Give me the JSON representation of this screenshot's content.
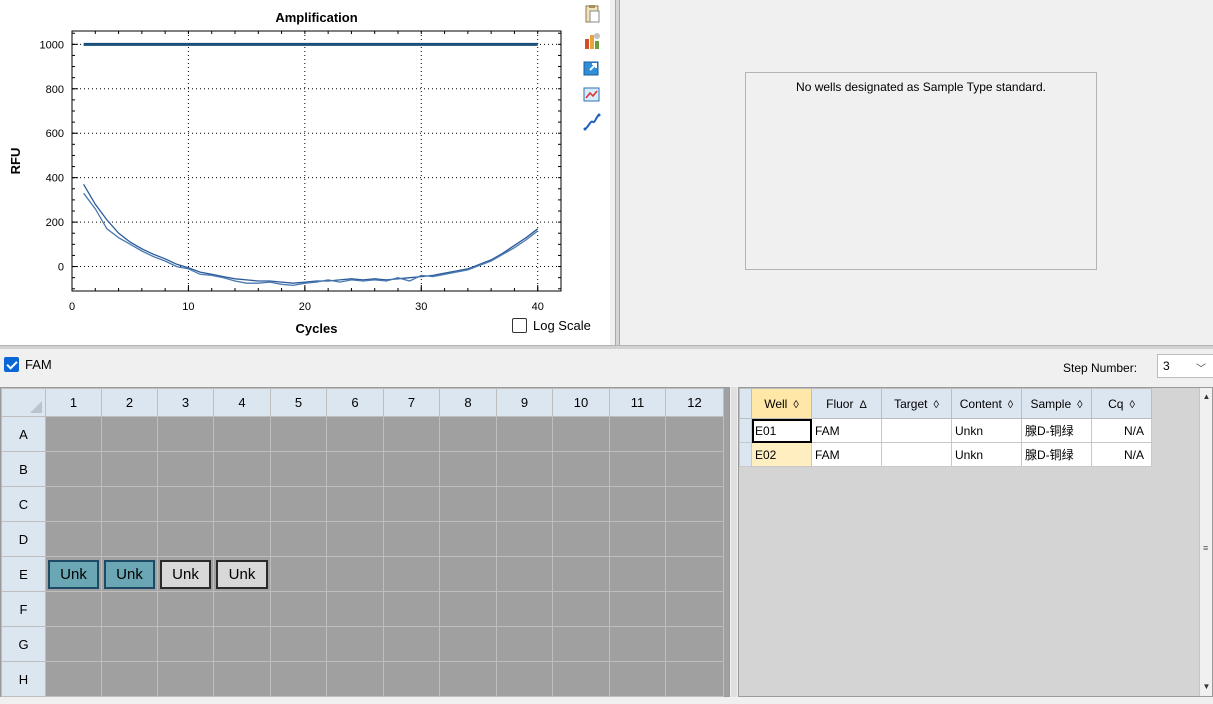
{
  "chart_data": {
    "type": "line",
    "title": "Amplification",
    "xlabel": "Cycles",
    "ylabel": "RFU",
    "xlim": [
      0,
      42
    ],
    "ylim": [
      -110,
      1060
    ],
    "xticks": [
      0,
      10,
      20,
      30,
      40
    ],
    "yticks": [
      0,
      200,
      400,
      600,
      800,
      1000
    ],
    "grid": true,
    "color": "#1f4e8c",
    "threshold": {
      "x": [
        1,
        40
      ],
      "y": [
        1000,
        1000
      ]
    },
    "series": [
      {
        "x": [
          1,
          2,
          3,
          4,
          5,
          6,
          7,
          8,
          9,
          10,
          11,
          12,
          13,
          14,
          15,
          16,
          17,
          18,
          19,
          20,
          21,
          22,
          23,
          24,
          25,
          26,
          27,
          28,
          29,
          30,
          31,
          32,
          33,
          34,
          35,
          36,
          37,
          38,
          39,
          40
        ],
        "y": [
          370,
          280,
          210,
          150,
          110,
          80,
          55,
          35,
          10,
          -5,
          -25,
          -35,
          -45,
          -55,
          -60,
          -65,
          -65,
          -70,
          -75,
          -70,
          -65,
          -65,
          -60,
          -55,
          -60,
          -55,
          -60,
          -55,
          -50,
          -45,
          -40,
          -30,
          -20,
          -10,
          10,
          30,
          60,
          95,
          130,
          170
        ]
      },
      {
        "x": [
          1,
          2,
          3,
          4,
          5,
          6,
          7,
          8,
          9,
          10,
          11,
          12,
          13,
          14,
          15,
          16,
          17,
          18,
          19,
          20,
          21,
          22,
          23,
          24,
          25,
          26,
          27,
          28,
          29,
          30,
          31,
          32,
          33,
          34,
          35,
          36,
          37,
          38,
          39,
          40
        ],
        "y": [
          330,
          260,
          170,
          130,
          100,
          70,
          45,
          25,
          0,
          -10,
          -35,
          -40,
          -50,
          -65,
          -75,
          -75,
          -70,
          -80,
          -85,
          -75,
          -70,
          -60,
          -70,
          -60,
          -65,
          -60,
          -65,
          -50,
          -65,
          -40,
          -45,
          -35,
          -25,
          -15,
          5,
          25,
          55,
          85,
          120,
          160
        ]
      }
    ]
  },
  "chart_ui": {
    "log_scale_label": "Log Scale",
    "tools": [
      "clipboard-icon",
      "bar-chart-icon",
      "export-icon",
      "zoom-chart-icon",
      "curve-icon"
    ]
  },
  "std_curve": {
    "message": "No wells designated as Sample Type standard."
  },
  "fluor": {
    "label": "FAM",
    "checked": true
  },
  "step": {
    "label": "Step Number:",
    "value": "3"
  },
  "plate": {
    "columns": [
      "1",
      "2",
      "3",
      "4",
      "5",
      "6",
      "7",
      "8",
      "9",
      "10",
      "11",
      "12"
    ],
    "rows": [
      "A",
      "B",
      "C",
      "D",
      "E",
      "F",
      "G",
      "H"
    ],
    "wells": [
      {
        "row": "E",
        "col": "1",
        "label": "Unk",
        "selected": true
      },
      {
        "row": "E",
        "col": "2",
        "label": "Unk",
        "selected": true
      },
      {
        "row": "E",
        "col": "3",
        "label": "Unk",
        "selected": false
      },
      {
        "row": "E",
        "col": "4",
        "label": "Unk",
        "selected": false
      }
    ]
  },
  "table": {
    "headers": [
      {
        "label": "Well",
        "sort": "◊"
      },
      {
        "label": "Fluor",
        "sort": "Δ"
      },
      {
        "label": "Target",
        "sort": "◊"
      },
      {
        "label": "Content",
        "sort": "◊"
      },
      {
        "label": "Sample",
        "sort": "◊"
      },
      {
        "label": "Cq",
        "sort": "◊"
      }
    ],
    "rows": [
      {
        "well": "E01",
        "fluor": "FAM",
        "target": "",
        "content": "Unkn",
        "sample": "腺D-铜绿",
        "cq": "N/A"
      },
      {
        "well": "E02",
        "fluor": "FAM",
        "target": "",
        "content": "Unkn",
        "sample": "腺D-铜绿",
        "cq": "N/A"
      }
    ]
  }
}
